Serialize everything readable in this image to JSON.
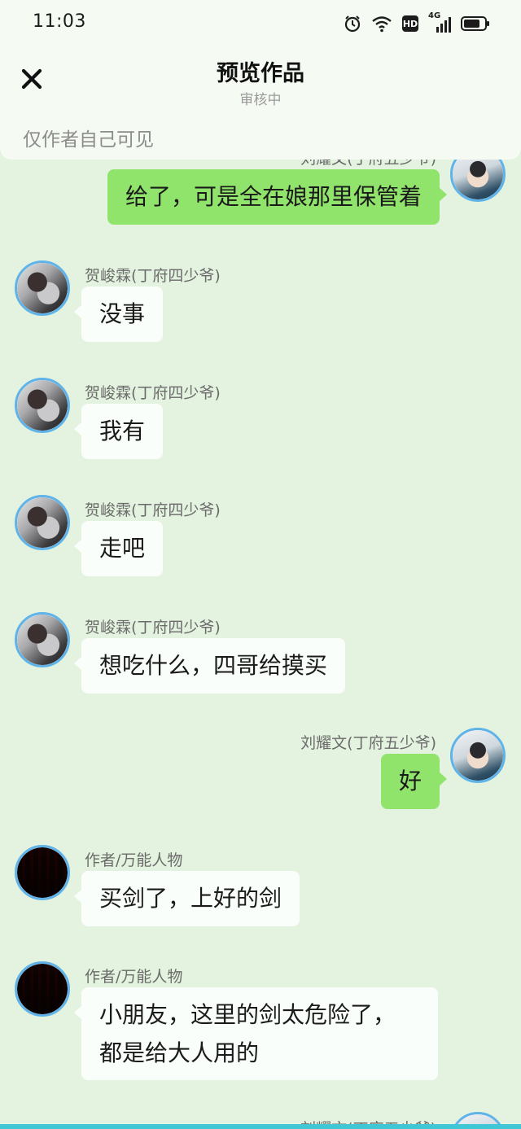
{
  "status_bar": {
    "time": "11:03",
    "network": "4G",
    "hd_label": "HD",
    "icons": [
      "alarm-icon",
      "wifi-icon",
      "hd-icon",
      "signal-icon",
      "battery-icon"
    ]
  },
  "header": {
    "title": "预览作品",
    "subtitle": "审核中",
    "visibility_note": "仅作者自己可见",
    "close_icon": "close-icon"
  },
  "messages": [
    {
      "sender": "刘耀文(丁府五少爷)",
      "text": "给了，可是全在娘那里保管着",
      "side": "right",
      "avatar": "liu"
    },
    {
      "sender": "贺峻霖(丁府四少爷)",
      "text": "没事",
      "side": "left",
      "avatar": "he"
    },
    {
      "sender": "贺峻霖(丁府四少爷)",
      "text": "我有",
      "side": "left",
      "avatar": "he"
    },
    {
      "sender": "贺峻霖(丁府四少爷)",
      "text": "走吧",
      "side": "left",
      "avatar": "he"
    },
    {
      "sender": "贺峻霖(丁府四少爷)",
      "text": "想吃什么，四哥给摸买",
      "side": "left",
      "avatar": "he"
    },
    {
      "sender": "刘耀文(丁府五少爷)",
      "text": "好",
      "side": "right",
      "avatar": "liu"
    },
    {
      "sender": "作者/万能人物",
      "text": "买剑了，上好的剑",
      "side": "left",
      "avatar": "author"
    },
    {
      "sender": "作者/万能人物",
      "text_lines": [
        "小朋友，这里的剑太危险了，",
        "都是给大人用的"
      ],
      "side": "left",
      "avatar": "author"
    },
    {
      "sender": "刘耀文(丁府五少爷)",
      "text": "",
      "side": "right",
      "avatar": "liu"
    }
  ],
  "colors": {
    "background": "#e4f3df",
    "header_bg": "#f5fbf2",
    "outgoing_bubble": "#90e36b",
    "incoming_bubble": "#fafefb",
    "avatar_ring": "#5fb3e8"
  }
}
